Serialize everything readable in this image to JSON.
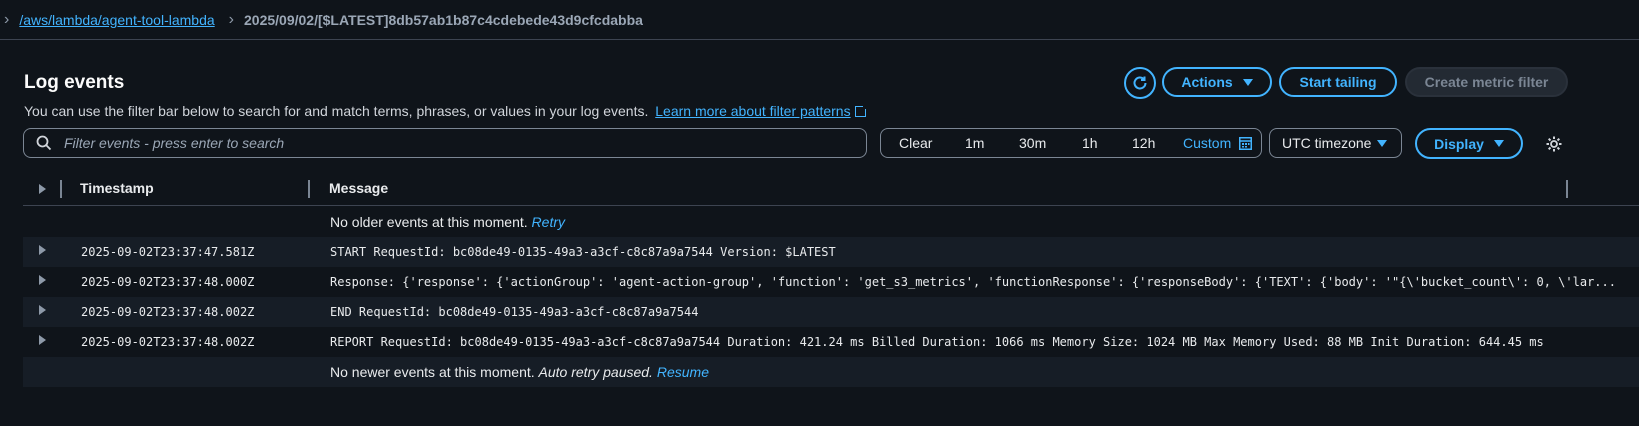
{
  "breadcrumb": {
    "log_group": "/aws/lambda/agent-tool-lambda",
    "log_stream": "2025/09/02/[$LATEST]8db57ab1b87c4cdebede43d9cfcdabba"
  },
  "header": {
    "title": "Log events",
    "description": "You can use the filter bar below to search for and match terms, phrases, or values in your log events.",
    "learn_more": "Learn more about filter patterns"
  },
  "actions": {
    "actions_label": "Actions",
    "start_tailing": "Start tailing",
    "create_metric_filter": "Create metric filter"
  },
  "filter": {
    "placeholder": "Filter events - press enter to search",
    "value": ""
  },
  "time_range": {
    "clear": "Clear",
    "options": [
      "1m",
      "30m",
      "1h",
      "12h"
    ],
    "custom": "Custom"
  },
  "timezone": "UTC timezone",
  "display_label": "Display",
  "table": {
    "columns": [
      "Timestamp",
      "Message"
    ],
    "no_older": "No older events at this moment.",
    "retry": "Retry",
    "no_newer": "No newer events at this moment.",
    "auto_retry": "Auto retry paused.",
    "resume": "Resume",
    "rows": [
      {
        "timestamp": "2025-09-02T23:37:47.581Z",
        "message": "START RequestId: bc08de49-0135-49a3-a3cf-c8c87a9a7544 Version: $LATEST"
      },
      {
        "timestamp": "2025-09-02T23:37:48.000Z",
        "message": "Response: {'response': {'actionGroup': 'agent-action-group', 'function': 'get_s3_metrics', 'functionResponse': {'responseBody': {'TEXT': {'body': '\"{\\'bucket_count\\': 0, \\'lar..."
      },
      {
        "timestamp": "2025-09-02T23:37:48.002Z",
        "message": "END RequestId: bc08de49-0135-49a3-a3cf-c8c87a9a7544"
      },
      {
        "timestamp": "2025-09-02T23:37:48.002Z",
        "message": "REPORT RequestId: bc08de49-0135-49a3-a3cf-c8c87a9a7544 Duration: 421.24 ms Billed Duration: 1066 ms Memory Size: 1024 MB Max Memory Used: 88 MB Init Duration: 644.45 ms"
      }
    ]
  }
}
